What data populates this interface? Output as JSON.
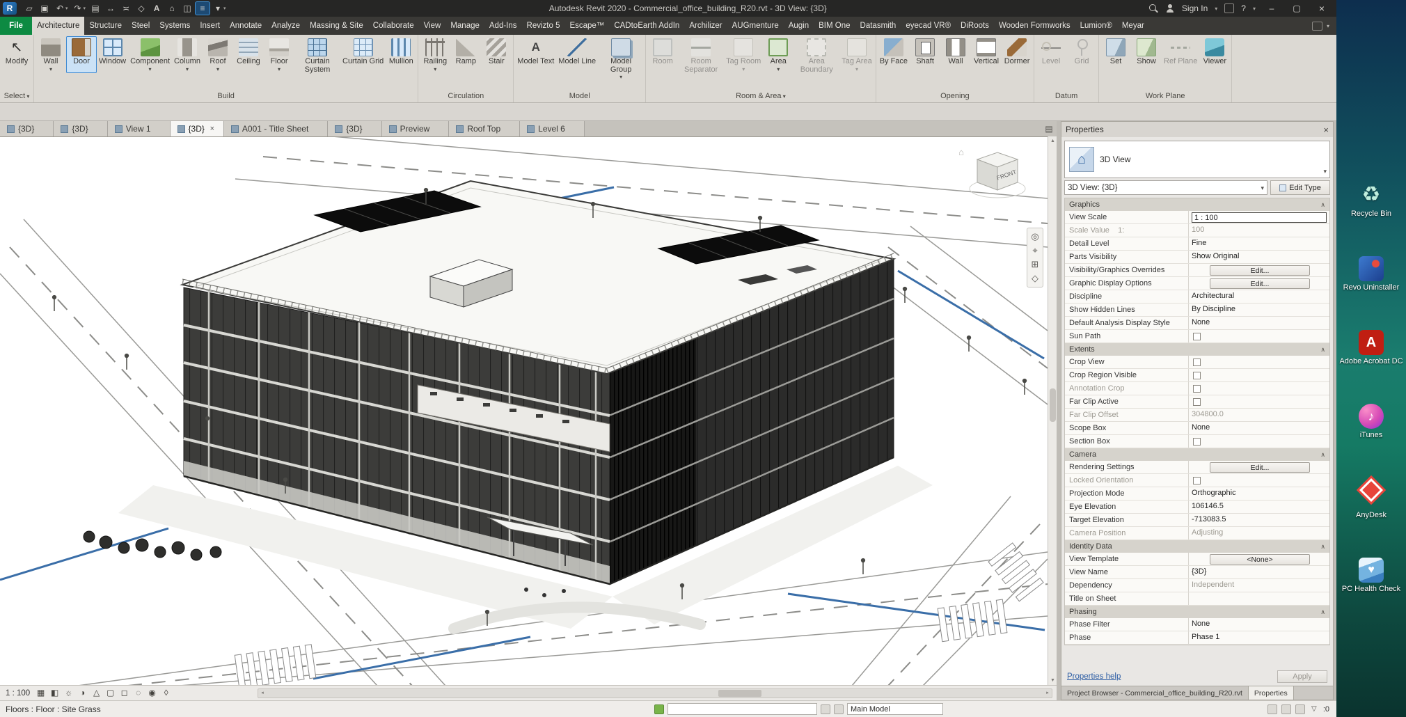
{
  "title_bar": {
    "title": "Autodesk Revit 2020 - Commercial_office_building_R20.rvt - 3D View: {3D}",
    "sign_in": "Sign In",
    "help": "?",
    "qat": [
      {
        "icon": "open"
      },
      {
        "icon": "save"
      },
      {
        "icon": "undo",
        "drop": true
      },
      {
        "icon": "redo",
        "drop": true
      },
      {
        "icon": "print"
      },
      {
        "icon": "measure"
      },
      {
        "icon": "aligned-dimension"
      },
      {
        "icon": "tag-by-category"
      },
      {
        "icon": "text"
      },
      {
        "icon": "default-3d-view"
      },
      {
        "icon": "section"
      },
      {
        "icon": "thin-lines",
        "active": true
      },
      {
        "icon": "customize-qat",
        "drop": true
      }
    ]
  },
  "ribbon": {
    "file_tab": "File",
    "tabs": [
      {
        "label": "Architecture",
        "active": true
      },
      {
        "label": "Structure"
      },
      {
        "label": "Steel"
      },
      {
        "label": "Systems"
      },
      {
        "label": "Insert"
      },
      {
        "label": "Annotate"
      },
      {
        "label": "Analyze"
      },
      {
        "label": "Massing & Site"
      },
      {
        "label": "Collaborate"
      },
      {
        "label": "View"
      },
      {
        "label": "Manage"
      },
      {
        "label": "Add-Ins"
      },
      {
        "label": "Revizto 5"
      },
      {
        "label": "Escape™"
      },
      {
        "label": "CADtoEarth AddIn"
      },
      {
        "label": "Archilizer"
      },
      {
        "label": "AUGmenture"
      },
      {
        "label": "Augin"
      },
      {
        "label": "BIM One"
      },
      {
        "label": "Datasmith"
      },
      {
        "label": "eyecad VR®"
      },
      {
        "label": "DiRoots"
      },
      {
        "label": "Wooden Formworks"
      },
      {
        "label": "Lumion®"
      },
      {
        "label": "Meyar"
      }
    ],
    "panels": [
      {
        "label": "Select",
        "buttons": [
          {
            "label": "Modify",
            "icon": "modify"
          }
        ]
      },
      {
        "label": "Build",
        "buttons": [
          {
            "label": "Wall",
            "icon": "wall",
            "arrow": true
          },
          {
            "label": "Door",
            "icon": "door",
            "selected": true
          },
          {
            "label": "Window",
            "icon": "window"
          },
          {
            "label": "Component",
            "icon": "component",
            "arrow": true
          },
          {
            "label": "Column",
            "icon": "column",
            "arrow": true
          },
          {
            "label": "Roof",
            "icon": "roof",
            "arrow": true
          },
          {
            "label": "Ceiling",
            "icon": "ceiling"
          },
          {
            "label": "Floor",
            "icon": "floor",
            "arrow": true
          },
          {
            "label": "Curtain System",
            "icon": "curtain-system"
          },
          {
            "label": "Curtain Grid",
            "icon": "curtain-grid"
          },
          {
            "label": "Mullion",
            "icon": "mullion"
          }
        ]
      },
      {
        "label": "Circulation",
        "buttons": [
          {
            "label": "Railing",
            "icon": "railing",
            "arrow": true
          },
          {
            "label": "Ramp",
            "icon": "ramp"
          },
          {
            "label": "Stair",
            "icon": "stair"
          }
        ]
      },
      {
        "label": "Model",
        "buttons": [
          {
            "label": "Model Text",
            "icon": "model-text"
          },
          {
            "label": "Model Line",
            "icon": "model-line"
          },
          {
            "label": "Model Group",
            "icon": "model-group",
            "arrow": true
          }
        ]
      },
      {
        "label": "Room & Area",
        "arrow": true,
        "buttons": [
          {
            "label": "Room",
            "icon": "room",
            "disabled": true
          },
          {
            "label": "Room Separator",
            "icon": "room-separator",
            "disabled": true
          },
          {
            "label": "Tag Room",
            "icon": "tag-room",
            "arrow": true,
            "disabled": true
          },
          {
            "label": "Area",
            "icon": "area",
            "arrow": true
          },
          {
            "label": "Area Boundary",
            "icon": "area-boundary",
            "disabled": true
          },
          {
            "label": "Tag Area",
            "icon": "tag-area",
            "arrow": true,
            "disabled": true
          }
        ]
      },
      {
        "label": "Opening",
        "buttons": [
          {
            "label": "By Face",
            "icon": "opening-by-face"
          },
          {
            "label": "Shaft",
            "icon": "shaft"
          },
          {
            "label": "Wall",
            "icon": "wall-opening"
          },
          {
            "label": "Vertical",
            "icon": "vertical-opening"
          },
          {
            "label": "Dormer",
            "icon": "dormer"
          }
        ]
      },
      {
        "label": "Datum",
        "buttons": [
          {
            "label": "Level",
            "icon": "level",
            "disabled": true
          },
          {
            "label": "Grid",
            "icon": "grid",
            "disabled": true
          }
        ]
      },
      {
        "label": "Work Plane",
        "buttons": [
          {
            "label": "Set",
            "icon": "set-work-plane"
          },
          {
            "label": "Show",
            "icon": "show-work-plane"
          },
          {
            "label": "Ref Plane",
            "icon": "ref-plane",
            "disabled": true
          },
          {
            "label": "Viewer",
            "icon": "viewer"
          }
        ]
      }
    ]
  },
  "view_tabs": [
    {
      "label": "{3D}"
    },
    {
      "label": "{3D}"
    },
    {
      "label": "View 1"
    },
    {
      "label": "{3D}",
      "active": true,
      "closable": true
    },
    {
      "label": "A001 - Title Sheet"
    },
    {
      "label": "{3D}"
    },
    {
      "label": "Preview"
    },
    {
      "label": "Roof Top"
    },
    {
      "label": "Level 6"
    }
  ],
  "canvas": {
    "viewcube_front": "FRONT"
  },
  "view_control_bar": {
    "scale": "1 : 100",
    "icons": [
      {
        "icon": "detail-level"
      },
      {
        "icon": "visual-style"
      },
      {
        "icon": "sun-path"
      },
      {
        "icon": "shadows"
      },
      {
        "icon": "rendering"
      },
      {
        "icon": "crop-view"
      },
      {
        "icon": "crop-region"
      },
      {
        "icon": "temporary-hide"
      },
      {
        "icon": "reveal-hidden"
      },
      {
        "icon": "analytical-model"
      }
    ]
  },
  "properties": {
    "panel_title": "Properties",
    "type_selector": "3D View",
    "instance_selector": "3D View: {3D}",
    "edit_type": "Edit Type",
    "groups": [
      {
        "header": "Graphics",
        "rows": [
          {
            "label": "View Scale",
            "value": "1 : 100",
            "editing": true
          },
          {
            "label": "Scale Value    1:",
            "value": "100",
            "dim_label": true,
            "dim_value": true
          },
          {
            "label": "Detail Level",
            "value": "Fine"
          },
          {
            "label": "Parts Visibility",
            "value": "Show Original"
          },
          {
            "label": "Visibility/Graphics Overrides",
            "value": "Edit...",
            "button": true
          },
          {
            "label": "Graphic Display Options",
            "value": "Edit...",
            "button": true
          },
          {
            "label": "Discipline",
            "value": "Architectural"
          },
          {
            "label": "Show Hidden Lines",
            "value": "By Discipline"
          },
          {
            "label": "Default Analysis Display Style",
            "value": "None"
          },
          {
            "label": "Sun Path",
            "checkbox": true
          }
        ]
      },
      {
        "header": "Extents",
        "rows": [
          {
            "label": "Crop View",
            "checkbox": true
          },
          {
            "label": "Crop Region Visible",
            "checkbox": true
          },
          {
            "label": "Annotation Crop",
            "checkbox": true,
            "dim_label": true
          },
          {
            "label": "Far Clip Active",
            "checkbox": true
          },
          {
            "label": "Far Clip Offset",
            "value": "304800.0",
            "dim_label": true,
            "dim_value": true
          },
          {
            "label": "Scope Box",
            "value": "None"
          },
          {
            "label": "Section Box",
            "checkbox": true
          }
        ]
      },
      {
        "header": "Camera",
        "rows": [
          {
            "label": "Rendering Settings",
            "value": "Edit...",
            "button": true
          },
          {
            "label": "Locked Orientation",
            "checkbox": true,
            "dim_label": true
          },
          {
            "label": "Projection Mode",
            "value": "Orthographic"
          },
          {
            "label": "Eye Elevation",
            "value": "106146.5"
          },
          {
            "label": "Target Elevation",
            "value": "-713083.5"
          },
          {
            "label": "Camera Position",
            "value": "Adjusting",
            "dim_label": true,
            "dim_value": true
          }
        ]
      },
      {
        "header": "Identity Data",
        "rows": [
          {
            "label": "View Template",
            "value": "<None>",
            "button": true
          },
          {
            "label": "View Name",
            "value": "{3D}"
          },
          {
            "label": "Dependency",
            "value": "Independent",
            "dim_value": true
          },
          {
            "label": "Title on Sheet",
            "value": ""
          }
        ]
      },
      {
        "header": "Phasing",
        "rows": [
          {
            "label": "Phase Filter",
            "value": "None"
          },
          {
            "label": "Phase",
            "value": "Phase 1"
          }
        ]
      }
    ],
    "help_link": "Properties help",
    "apply_label": "Apply",
    "bottom_tabs": [
      "Project Browser - Commercial_office_building_R20.rvt",
      "Properties"
    ]
  },
  "status_bar": {
    "message": "Floors : Floor : Site Grass",
    "workset_value": "",
    "design_option_value": "Main Model",
    "selection_count": ":0"
  },
  "desktop": {
    "icons": [
      {
        "label": "Recycle Bin",
        "icon": "recycle-bin"
      },
      {
        "label": "Revo Uninstaller",
        "icon": "revo-uninstaller"
      },
      {
        "label": "Adobe Acrobat DC",
        "icon": "adobe-acrobat"
      },
      {
        "label": "iTunes",
        "icon": "itunes"
      },
      {
        "label": "AnyDesk",
        "icon": "anydesk"
      },
      {
        "label": "PC Health Check",
        "icon": "pc-health-check"
      }
    ]
  }
}
